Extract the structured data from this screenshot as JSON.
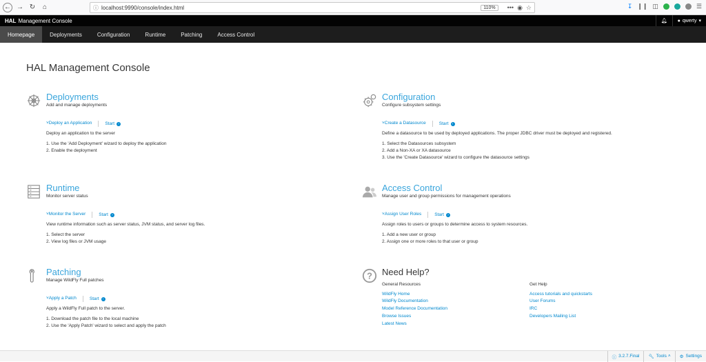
{
  "browser": {
    "url": "localhost:9990/console/index.html",
    "zoom": "110%",
    "menu_dots": "•••"
  },
  "hal_bar": {
    "brand": "HAL",
    "title": "Management Console",
    "user": "qwerty"
  },
  "nav": {
    "tabs": [
      "Homepage",
      "Deployments",
      "Configuration",
      "Runtime",
      "Patching",
      "Access Control"
    ]
  },
  "main": {
    "page_title": "HAL Management Console",
    "deployments": {
      "title": "Deployments",
      "subtitle": "Add and manage deployments",
      "action": "Deploy an Application",
      "start": "Start",
      "description": "Deploy an application to the server",
      "steps": [
        "1. Use the 'Add Deployment' wizard to deploy the application",
        "2. Enable the deployment"
      ]
    },
    "configuration": {
      "title": "Configuration",
      "subtitle": "Configure subsystem settings",
      "action": "Create a Datasource",
      "start": "Start",
      "description": "Define a datasource to be used by deployed applications. The proper JDBC driver must be deployed and registered.",
      "steps": [
        "1. Select the Datasources subsystem",
        "2. Add a Non-XA or XA datasource",
        "3. Use the 'Create Datasource' wizard to configure the datasource settings"
      ]
    },
    "runtime": {
      "title": "Runtime",
      "subtitle": "Monitor server status",
      "action": "Monitor the Server",
      "start": "Start",
      "description": "View runtime information such as server status, JVM status, and server log files.",
      "steps": [
        "1. Select the server",
        "2. View log files or JVM usage"
      ]
    },
    "access_control": {
      "title": "Access Control",
      "subtitle": "Manage user and group permissions for management operations",
      "action": "Assign User Roles",
      "start": "Start",
      "description": "Assign roles to users or groups to determine access to system resources.",
      "steps": [
        "1. Add a new user or group",
        "2. Assign one or more roles to that user or group"
      ]
    },
    "patching": {
      "title": "Patching",
      "subtitle": "Manage WildFly Full patches",
      "action": "Apply a Patch",
      "start": "Start",
      "description": "Apply a WildFly Full patch to the server.",
      "steps": [
        "1. Download the patch file to the local machine",
        "2. Use the 'Apply Patch' wizard to select and apply the patch"
      ]
    },
    "help": {
      "title": "Need Help?",
      "general_resources": {
        "heading": "General Resources",
        "links": [
          "WildFly Home",
          "WildFly Documentation",
          "Model Reference Documentation",
          "Browse Issues",
          "Latest News"
        ]
      },
      "get_help": {
        "heading": "Get Help",
        "links": [
          "Access tutorials and quickstarts",
          "User Forums",
          "IRC",
          "Developers Mailing List"
        ]
      }
    }
  },
  "footer": {
    "version": "3.2.7.Final",
    "tools": "Tools",
    "settings": "Settings"
  }
}
